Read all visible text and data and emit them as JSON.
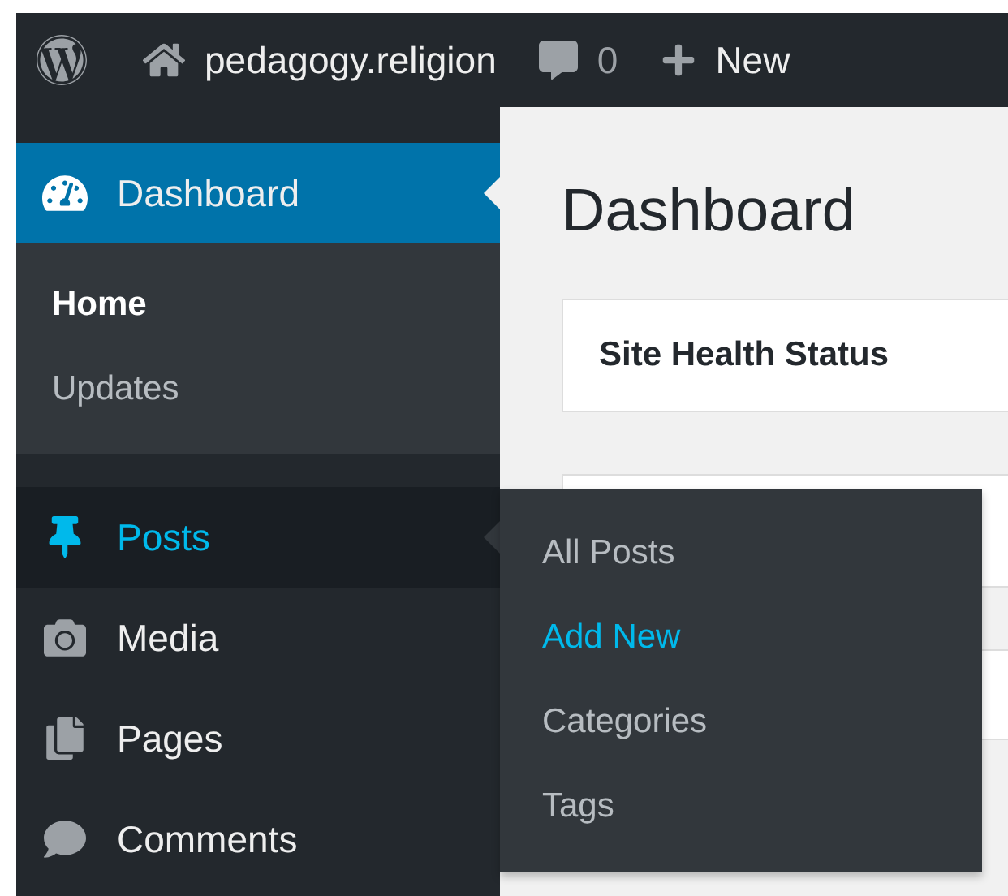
{
  "admin_bar": {
    "site_name": "pedagogy.religion",
    "comments_count": "0",
    "new_label": "New"
  },
  "sidebar": {
    "items": [
      {
        "label": "Dashboard",
        "selected": true,
        "hovered": false,
        "submenu": [
          {
            "label": "Home",
            "selected": true,
            "hovered": false
          },
          {
            "label": "Updates",
            "selected": false,
            "hovered": false
          }
        ]
      },
      {
        "label": "Posts",
        "selected": false,
        "hovered": true,
        "submenu": [
          {
            "label": "All Posts",
            "selected": false,
            "hovered": false
          },
          {
            "label": "Add New",
            "selected": false,
            "hovered": true
          },
          {
            "label": "Categories",
            "selected": false,
            "hovered": false
          },
          {
            "label": "Tags",
            "selected": false,
            "hovered": false
          }
        ]
      },
      {
        "label": "Media",
        "selected": false,
        "hovered": false
      },
      {
        "label": "Pages",
        "selected": false,
        "hovered": false
      },
      {
        "label": "Comments",
        "selected": false,
        "hovered": false
      }
    ]
  },
  "content": {
    "heading": "Dashboard",
    "cards": [
      {
        "title": "Site Health Status"
      }
    ]
  }
}
